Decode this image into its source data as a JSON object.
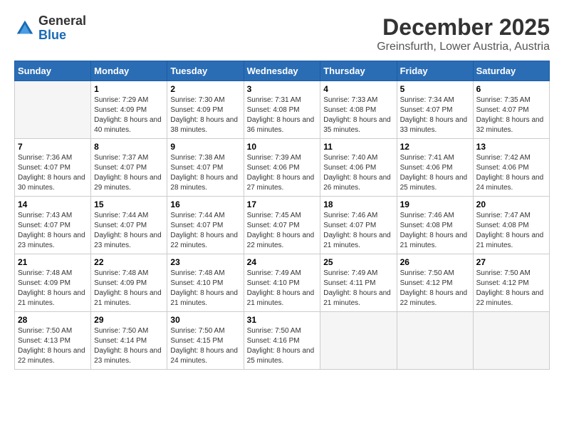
{
  "logo": {
    "general": "General",
    "blue": "Blue"
  },
  "title": {
    "month": "December 2025",
    "location": "Greinsfurth, Lower Austria, Austria"
  },
  "weekdays": [
    "Sunday",
    "Monday",
    "Tuesday",
    "Wednesday",
    "Thursday",
    "Friday",
    "Saturday"
  ],
  "weeks": [
    [
      {
        "day": "",
        "sunrise": "",
        "sunset": "",
        "daylight": "",
        "empty": true
      },
      {
        "day": "1",
        "sunrise": "Sunrise: 7:29 AM",
        "sunset": "Sunset: 4:09 PM",
        "daylight": "Daylight: 8 hours and 40 minutes."
      },
      {
        "day": "2",
        "sunrise": "Sunrise: 7:30 AM",
        "sunset": "Sunset: 4:09 PM",
        "daylight": "Daylight: 8 hours and 38 minutes."
      },
      {
        "day": "3",
        "sunrise": "Sunrise: 7:31 AM",
        "sunset": "Sunset: 4:08 PM",
        "daylight": "Daylight: 8 hours and 36 minutes."
      },
      {
        "day": "4",
        "sunrise": "Sunrise: 7:33 AM",
        "sunset": "Sunset: 4:08 PM",
        "daylight": "Daylight: 8 hours and 35 minutes."
      },
      {
        "day": "5",
        "sunrise": "Sunrise: 7:34 AM",
        "sunset": "Sunset: 4:07 PM",
        "daylight": "Daylight: 8 hours and 33 minutes."
      },
      {
        "day": "6",
        "sunrise": "Sunrise: 7:35 AM",
        "sunset": "Sunset: 4:07 PM",
        "daylight": "Daylight: 8 hours and 32 minutes."
      }
    ],
    [
      {
        "day": "7",
        "sunrise": "Sunrise: 7:36 AM",
        "sunset": "Sunset: 4:07 PM",
        "daylight": "Daylight: 8 hours and 30 minutes."
      },
      {
        "day": "8",
        "sunrise": "Sunrise: 7:37 AM",
        "sunset": "Sunset: 4:07 PM",
        "daylight": "Daylight: 8 hours and 29 minutes."
      },
      {
        "day": "9",
        "sunrise": "Sunrise: 7:38 AM",
        "sunset": "Sunset: 4:07 PM",
        "daylight": "Daylight: 8 hours and 28 minutes."
      },
      {
        "day": "10",
        "sunrise": "Sunrise: 7:39 AM",
        "sunset": "Sunset: 4:06 PM",
        "daylight": "Daylight: 8 hours and 27 minutes."
      },
      {
        "day": "11",
        "sunrise": "Sunrise: 7:40 AM",
        "sunset": "Sunset: 4:06 PM",
        "daylight": "Daylight: 8 hours and 26 minutes."
      },
      {
        "day": "12",
        "sunrise": "Sunrise: 7:41 AM",
        "sunset": "Sunset: 4:06 PM",
        "daylight": "Daylight: 8 hours and 25 minutes."
      },
      {
        "day": "13",
        "sunrise": "Sunrise: 7:42 AM",
        "sunset": "Sunset: 4:06 PM",
        "daylight": "Daylight: 8 hours and 24 minutes."
      }
    ],
    [
      {
        "day": "14",
        "sunrise": "Sunrise: 7:43 AM",
        "sunset": "Sunset: 4:07 PM",
        "daylight": "Daylight: 8 hours and 23 minutes."
      },
      {
        "day": "15",
        "sunrise": "Sunrise: 7:44 AM",
        "sunset": "Sunset: 4:07 PM",
        "daylight": "Daylight: 8 hours and 23 minutes."
      },
      {
        "day": "16",
        "sunrise": "Sunrise: 7:44 AM",
        "sunset": "Sunset: 4:07 PM",
        "daylight": "Daylight: 8 hours and 22 minutes."
      },
      {
        "day": "17",
        "sunrise": "Sunrise: 7:45 AM",
        "sunset": "Sunset: 4:07 PM",
        "daylight": "Daylight: 8 hours and 22 minutes."
      },
      {
        "day": "18",
        "sunrise": "Sunrise: 7:46 AM",
        "sunset": "Sunset: 4:07 PM",
        "daylight": "Daylight: 8 hours and 21 minutes."
      },
      {
        "day": "19",
        "sunrise": "Sunrise: 7:46 AM",
        "sunset": "Sunset: 4:08 PM",
        "daylight": "Daylight: 8 hours and 21 minutes."
      },
      {
        "day": "20",
        "sunrise": "Sunrise: 7:47 AM",
        "sunset": "Sunset: 4:08 PM",
        "daylight": "Daylight: 8 hours and 21 minutes."
      }
    ],
    [
      {
        "day": "21",
        "sunrise": "Sunrise: 7:48 AM",
        "sunset": "Sunset: 4:09 PM",
        "daylight": "Daylight: 8 hours and 21 minutes."
      },
      {
        "day": "22",
        "sunrise": "Sunrise: 7:48 AM",
        "sunset": "Sunset: 4:09 PM",
        "daylight": "Daylight: 8 hours and 21 minutes."
      },
      {
        "day": "23",
        "sunrise": "Sunrise: 7:48 AM",
        "sunset": "Sunset: 4:10 PM",
        "daylight": "Daylight: 8 hours and 21 minutes."
      },
      {
        "day": "24",
        "sunrise": "Sunrise: 7:49 AM",
        "sunset": "Sunset: 4:10 PM",
        "daylight": "Daylight: 8 hours and 21 minutes."
      },
      {
        "day": "25",
        "sunrise": "Sunrise: 7:49 AM",
        "sunset": "Sunset: 4:11 PM",
        "daylight": "Daylight: 8 hours and 21 minutes."
      },
      {
        "day": "26",
        "sunrise": "Sunrise: 7:50 AM",
        "sunset": "Sunset: 4:12 PM",
        "daylight": "Daylight: 8 hours and 22 minutes."
      },
      {
        "day": "27",
        "sunrise": "Sunrise: 7:50 AM",
        "sunset": "Sunset: 4:12 PM",
        "daylight": "Daylight: 8 hours and 22 minutes."
      }
    ],
    [
      {
        "day": "28",
        "sunrise": "Sunrise: 7:50 AM",
        "sunset": "Sunset: 4:13 PM",
        "daylight": "Daylight: 8 hours and 22 minutes."
      },
      {
        "day": "29",
        "sunrise": "Sunrise: 7:50 AM",
        "sunset": "Sunset: 4:14 PM",
        "daylight": "Daylight: 8 hours and 23 minutes."
      },
      {
        "day": "30",
        "sunrise": "Sunrise: 7:50 AM",
        "sunset": "Sunset: 4:15 PM",
        "daylight": "Daylight: 8 hours and 24 minutes."
      },
      {
        "day": "31",
        "sunrise": "Sunrise: 7:50 AM",
        "sunset": "Sunset: 4:16 PM",
        "daylight": "Daylight: 8 hours and 25 minutes."
      },
      {
        "day": "",
        "sunrise": "",
        "sunset": "",
        "daylight": "",
        "empty": true
      },
      {
        "day": "",
        "sunrise": "",
        "sunset": "",
        "daylight": "",
        "empty": true
      },
      {
        "day": "",
        "sunrise": "",
        "sunset": "",
        "daylight": "",
        "empty": true
      }
    ]
  ]
}
